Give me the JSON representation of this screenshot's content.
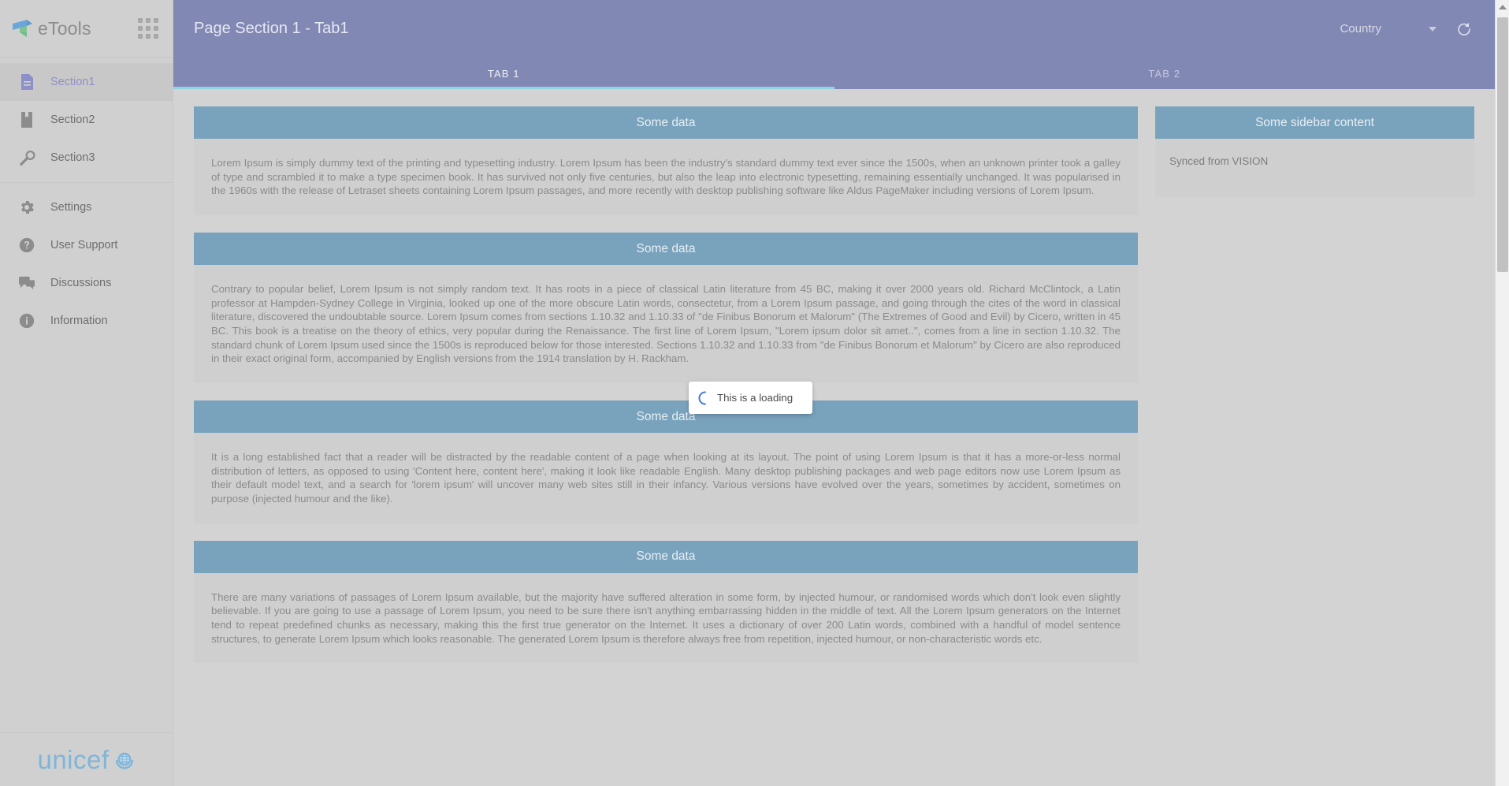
{
  "sidebar": {
    "brand": {
      "name": "eTools",
      "logo_icon": "etools-logo-icon",
      "apps_icon": "apps-grid-icon"
    },
    "items": [
      {
        "label": "Section1",
        "icon": "document-icon",
        "active": true
      },
      {
        "label": "Section2",
        "icon": "book-icon",
        "active": false
      },
      {
        "label": "Section3",
        "icon": "wrench-icon",
        "active": false
      },
      {
        "label": "Settings",
        "icon": "gear-icon",
        "active": false
      },
      {
        "label": "User Support",
        "icon": "help-circle-icon",
        "active": false
      },
      {
        "label": "Discussions",
        "icon": "chat-icon",
        "active": false
      },
      {
        "label": "Information",
        "icon": "info-circle-icon",
        "active": false
      }
    ],
    "footer_logo": {
      "word": "unicef",
      "emblem_icon": "unicef-globe-icon"
    }
  },
  "header": {
    "title": "Page Section 1 - Tab1",
    "country_selector": {
      "value": "Country",
      "caret_icon": "chevron-down-icon"
    },
    "refresh_icon": "refresh-icon",
    "tabs": [
      {
        "label": "TAB 1",
        "selected": true
      },
      {
        "label": "TAB 2",
        "selected": false
      }
    ]
  },
  "main": {
    "cards": [
      {
        "title": "Some data",
        "body": "Lorem Ipsum is simply dummy text of the printing and typesetting industry. Lorem Ipsum has been the industry's standard dummy text ever since the 1500s, when an unknown printer took a galley of type and scrambled it to make a type specimen book. It has survived not only five centuries, but also the leap into electronic typesetting, remaining essentially unchanged. It was popularised in the 1960s with the release of Letraset sheets containing Lorem Ipsum passages, and more recently with desktop publishing software like Aldus PageMaker including versions of Lorem Ipsum."
      },
      {
        "title": "Some data",
        "body": "Contrary to popular belief, Lorem Ipsum is not simply random text. It has roots in a piece of classical Latin literature from 45 BC, making it over 2000 years old. Richard McClintock, a Latin professor at Hampden-Sydney College in Virginia, looked up one of the more obscure Latin words, consectetur, from a Lorem Ipsum passage, and going through the cites of the word in classical literature, discovered the undoubtable source. Lorem Ipsum comes from sections 1.10.32 and 1.10.33 of \"de Finibus Bonorum et Malorum\" (The Extremes of Good and Evil) by Cicero, written in 45 BC. This book is a treatise on the theory of ethics, very popular during the Renaissance. The first line of Lorem Ipsum, \"Lorem ipsum dolor sit amet..\", comes from a line in section 1.10.32. The standard chunk of Lorem Ipsum used since the 1500s is reproduced below for those interested. Sections 1.10.32 and 1.10.33 from \"de Finibus Bonorum et Malorum\" by Cicero are also reproduced in their exact original form, accompanied by English versions from the 1914 translation by H. Rackham."
      },
      {
        "title": "Some data",
        "body": "It is a long established fact that a reader will be distracted by the readable content of a page when looking at its layout. The point of using Lorem Ipsum is that it has a more-or-less normal distribution of letters, as opposed to using 'Content here, content here', making it look like readable English. Many desktop publishing packages and web page editors now use Lorem Ipsum as their default model text, and a search for 'lorem ipsum' will uncover many web sites still in their infancy. Various versions have evolved over the years, sometimes by accident, sometimes on purpose (injected humour and the like)."
      },
      {
        "title": "Some data",
        "body": "There are many variations of passages of Lorem Ipsum available, but the majority have suffered alteration in some form, by injected humour, or randomised words which don't look even slightly believable. If you are going to use a passage of Lorem Ipsum, you need to be sure there isn't anything embarrassing hidden in the middle of text. All the Lorem Ipsum generators on the Internet tend to repeat predefined chunks as necessary, making this the first true generator on the Internet. It uses a dictionary of over 200 Latin words, combined with a handful of model sentence structures, to generate Lorem Ipsum which looks reasonable. The generated Lorem Ipsum is therefore always free from repetition, injected humour, or non-characteristic words etc."
      }
    ]
  },
  "sidebar_panel": {
    "title": "Some sidebar content",
    "body": "Synced from VISION"
  },
  "loading_toast": {
    "text": "This is a loading",
    "spinner_icon": "spinner-icon"
  },
  "scrollbar": {
    "up_arrow_icon": "scroll-up-arrow-icon"
  },
  "colors": {
    "header_purple": "#8288b4",
    "card_header_blue": "#79a3bd",
    "tab_indicator": "#8fd3e0",
    "page_bg": "#d3d3d3",
    "sidebar_bg": "#d0d0d0",
    "accent_active": "#8d90c8",
    "unicef_blue": "#7fb5d8",
    "spinner_blue": "#3f79e0"
  }
}
